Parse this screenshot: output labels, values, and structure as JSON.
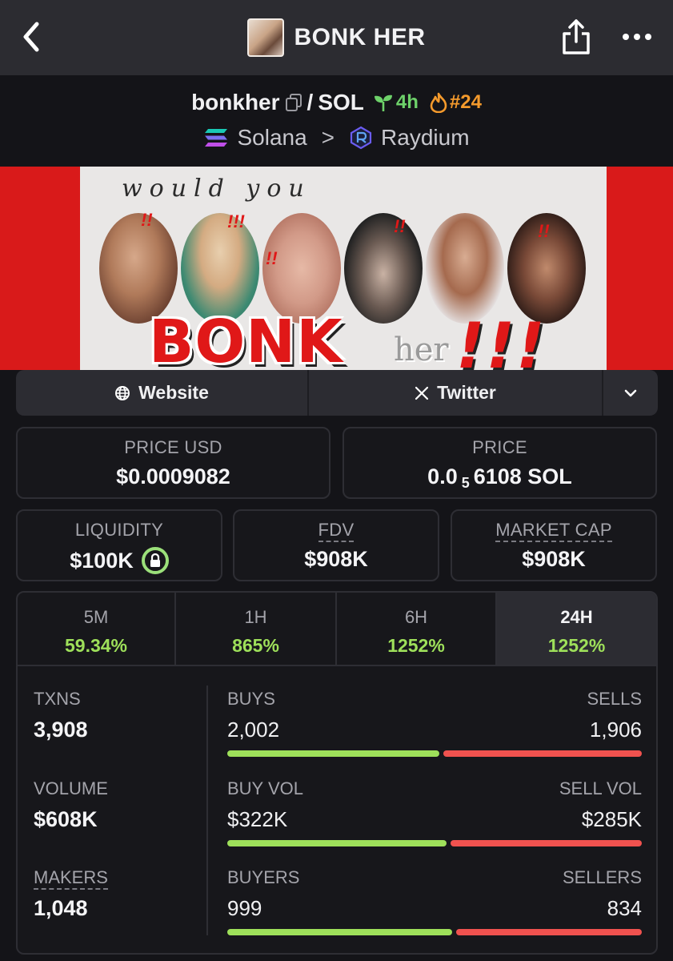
{
  "header": {
    "title": "BONK HER",
    "back_icon": "chevron-left-icon",
    "share_icon": "share-icon",
    "more_icon": "more-horizontal-icon"
  },
  "pair": {
    "base": "bonkher",
    "slash": "/",
    "quote": "SOL",
    "age": "4h",
    "rank": "#24",
    "chain": "Solana",
    "dex": "Raydium",
    "age_color": "#6ed26a",
    "rank_color": "#f49a2c"
  },
  "banner": {
    "line1": "would you",
    "word": "BONK",
    "her": "her",
    "excl": "!!!"
  },
  "links": {
    "website": "Website",
    "twitter": "Twitter"
  },
  "stats": {
    "price_usd_label": "PRICE USD",
    "price_usd": "$0.0009082",
    "price_label": "PRICE",
    "price_prefix": "0.0",
    "price_sub": "5",
    "price_suffix": "6108 SOL",
    "liquidity_label": "LIQUIDITY",
    "liquidity": "$100K",
    "fdv_label": "FDV",
    "fdv": "$908K",
    "mcap_label": "MARKET CAP",
    "mcap": "$908K"
  },
  "timeframes": [
    {
      "label": "5M",
      "change": "59.34%"
    },
    {
      "label": "1H",
      "change": "865%"
    },
    {
      "label": "6H",
      "change": "1252%"
    },
    {
      "label": "24H",
      "change": "1252%"
    }
  ],
  "active_timeframe": "24H",
  "activity": {
    "txns_label": "TXNS",
    "txns": "3,908",
    "volume_label": "VOLUME",
    "volume": "$608K",
    "makers_label": "MAKERS",
    "makers": "1,048",
    "buys_label": "BUYS",
    "buys": "2,002",
    "sells_label": "SELLS",
    "sells": "1,906",
    "buy_vol_label": "BUY VOL",
    "buy_vol": "$322K",
    "sell_vol_label": "SELL VOL",
    "sell_vol": "$285K",
    "buyers_label": "BUYERS",
    "buyers": "999",
    "sellers_label": "SELLERS",
    "sellers": "834"
  },
  "colors": {
    "positive": "#9ee05a",
    "negative": "#f0524f",
    "banner_red": "#d91a1a"
  }
}
